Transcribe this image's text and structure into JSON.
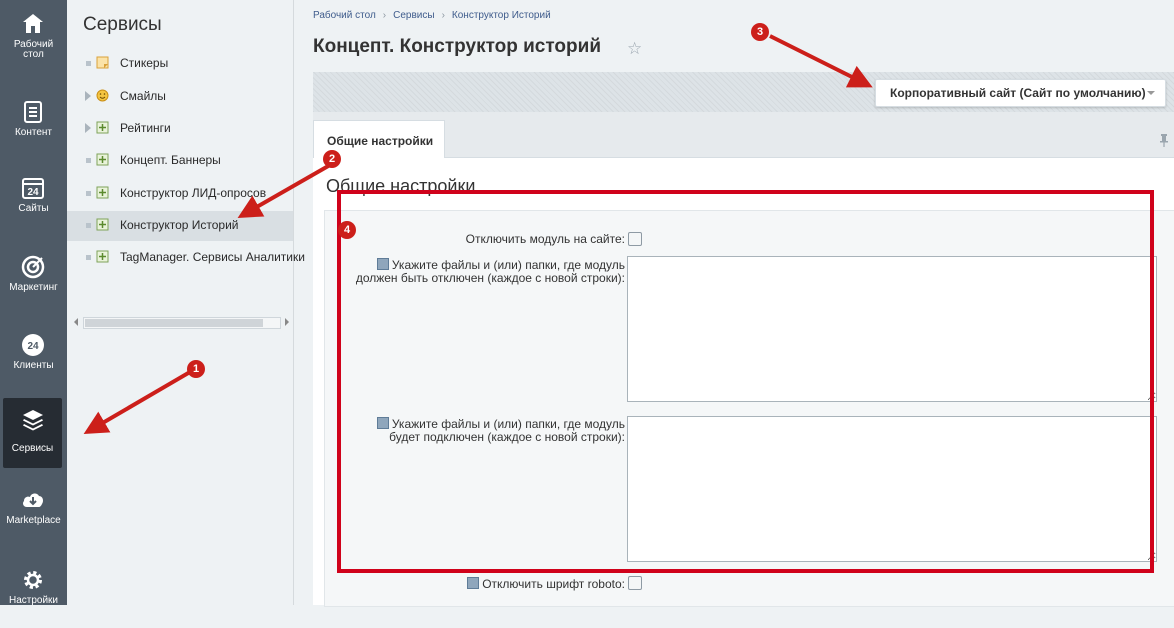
{
  "nav": {
    "items": [
      {
        "label_line1": "Рабочий",
        "label_line2": "стол"
      },
      {
        "label_line1": "Контент",
        "label_line2": ""
      },
      {
        "label_line1": "Сайты",
        "label_line2": ""
      },
      {
        "label_line1": "Маркетинг",
        "label_line2": ""
      },
      {
        "label_line1": "Клиенты",
        "label_line2": ""
      },
      {
        "label_line1": "Сервисы",
        "label_line2": ""
      },
      {
        "label_line1": "Marketplace",
        "label_line2": ""
      },
      {
        "label_line1": "Настройки",
        "label_line2": ""
      }
    ],
    "calendar_day": "24",
    "clients_badge": "24"
  },
  "tree": {
    "title": "Сервисы",
    "items": [
      {
        "label": "Стикеры",
        "icon": "sticker-icon"
      },
      {
        "label": "Смайлы",
        "icon": "smile-icon"
      },
      {
        "label": "Рейтинги",
        "icon": "module-icon"
      },
      {
        "label": "Концепт. Баннеры",
        "icon": "module-icon"
      },
      {
        "label": "Конструктор ЛИД-опросов",
        "icon": "module-icon"
      },
      {
        "label": "Конструктор Историй",
        "icon": "module-icon"
      },
      {
        "label": "TagManager. Сервисы Аналитики",
        "icon": "module-icon"
      }
    ]
  },
  "breadcrumb": {
    "items": [
      "Рабочий стол",
      "Сервисы",
      "Конструктор Историй"
    ],
    "separator": "›"
  },
  "page": {
    "title": "Концепт. Конструктор историй",
    "star_glyph": "☆"
  },
  "toolbar": {
    "site_select_value": "Корпоративный сайт (Сайт по умолчанию)"
  },
  "tabs": [
    {
      "label": "Общие настройки",
      "active": true
    }
  ],
  "form": {
    "section_title": "Общие настройки",
    "disable_module_label": "Отключить модуль на сайте:",
    "disabled_paths_label_line1": "Укажите файлы и (или) папки, где модуль",
    "disabled_paths_label_line2": "должен быть отключен (каждое с новой строки):",
    "enabled_paths_label_line1": "Укажите файлы и (или) папки, где модуль",
    "enabled_paths_label_line2": "будет подключен (каждое с новой строки):",
    "disable_roboto_label": "Отключить шрифт roboto:",
    "disable_module_checked": false,
    "disable_roboto_checked": false,
    "disabled_paths_value": "",
    "enabled_paths_value": ""
  },
  "annotations": {
    "badges": [
      "1",
      "2",
      "3",
      "4"
    ],
    "color": "#cc1f1a"
  },
  "colors": {
    "nav_bg": "#4e5a66",
    "nav_active_bg": "#262c33",
    "link": "#3f5c8c",
    "annotation_red": "#d0021b"
  }
}
